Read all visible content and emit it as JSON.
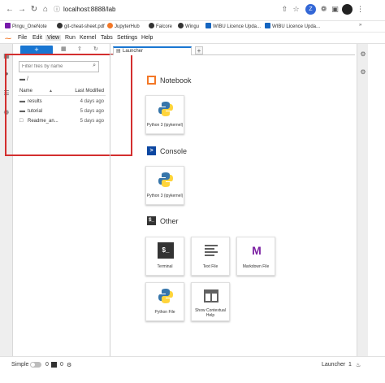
{
  "browser": {
    "url": "localhost:8888/lab",
    "bookmarks": [
      "Pingu_OneNote",
      "git-cheat-sheet.pdf",
      "JupyterHub",
      "Falcore",
      "Wingu",
      "WIBU Licence Upda...",
      "WIBU Licence Upda..."
    ],
    "profile_initial": "Z"
  },
  "menu": {
    "items": [
      "File",
      "Edit",
      "View",
      "Run",
      "Kernel",
      "Tabs",
      "Settings",
      "Help"
    ],
    "active": "View"
  },
  "filebrowser": {
    "new_label": "+",
    "filter_placeholder": "Filter files by name",
    "breadcrumb": "/",
    "col_name": "Name",
    "col_modified": "Last Modified",
    "files": [
      {
        "name": "results",
        "modified": "4 days ago",
        "type": "folder"
      },
      {
        "name": "tutorial",
        "modified": "5 days ago",
        "type": "folder"
      },
      {
        "name": "Readme_an...",
        "modified": "5 days ago",
        "type": "file"
      }
    ]
  },
  "tabs": {
    "launcher_label": "Launcher",
    "add_label": "+"
  },
  "launcher": {
    "notebook_title": "Notebook",
    "console_title": "Console",
    "other_title": "Other",
    "notebook_card": "Python 3 (ipykernel)",
    "console_card": "Python 3 (ipykernel)",
    "other_cards": [
      "Terminal",
      "Text File",
      "Markdown File",
      "Python File",
      "Show Contextual Help"
    ],
    "terminal_glyph": "$_",
    "markdown_glyph": "M"
  },
  "statusbar": {
    "simple_label": "Simple",
    "count_a": "0",
    "count_b": "0",
    "launcher_label": "Launcher",
    "page_count": "1"
  },
  "colors": {
    "accent_blue": "#1976d2",
    "jupyter_orange": "#f37726",
    "highlight_red": "#d32f2f",
    "markdown_purple": "#7b1fa2"
  }
}
